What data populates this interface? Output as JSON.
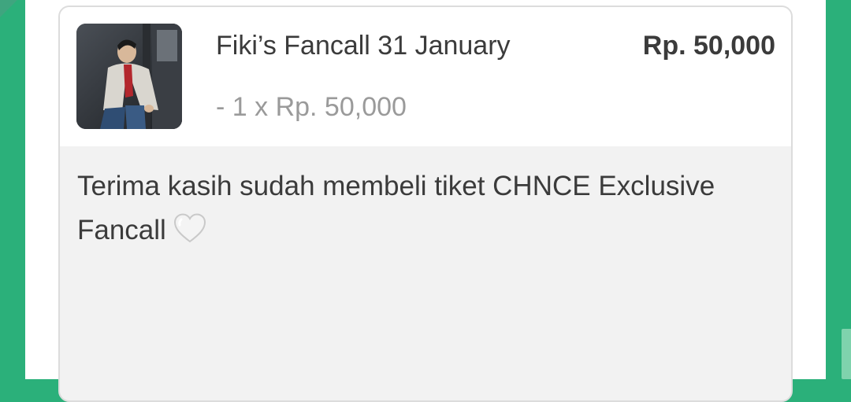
{
  "order": {
    "item_title": "Fiki’s Fancall 31 January",
    "item_price": "Rp. 50,000",
    "item_quantity_line": "- 1 x Rp. 50,000",
    "thumbnail_icon": "product-photo"
  },
  "note": {
    "message_line1": "Terima kasih sudah membeli tiket CHNCE Exclusive",
    "message_line2": "Fancall",
    "emoji_icon": "white-heart-icon"
  },
  "colors": {
    "brand_green": "#2bb07a",
    "card_border": "#dcdcdc",
    "note_background": "#f2f2f2",
    "primary_text": "#3b3b3b",
    "muted_text": "#9a9a9a"
  }
}
